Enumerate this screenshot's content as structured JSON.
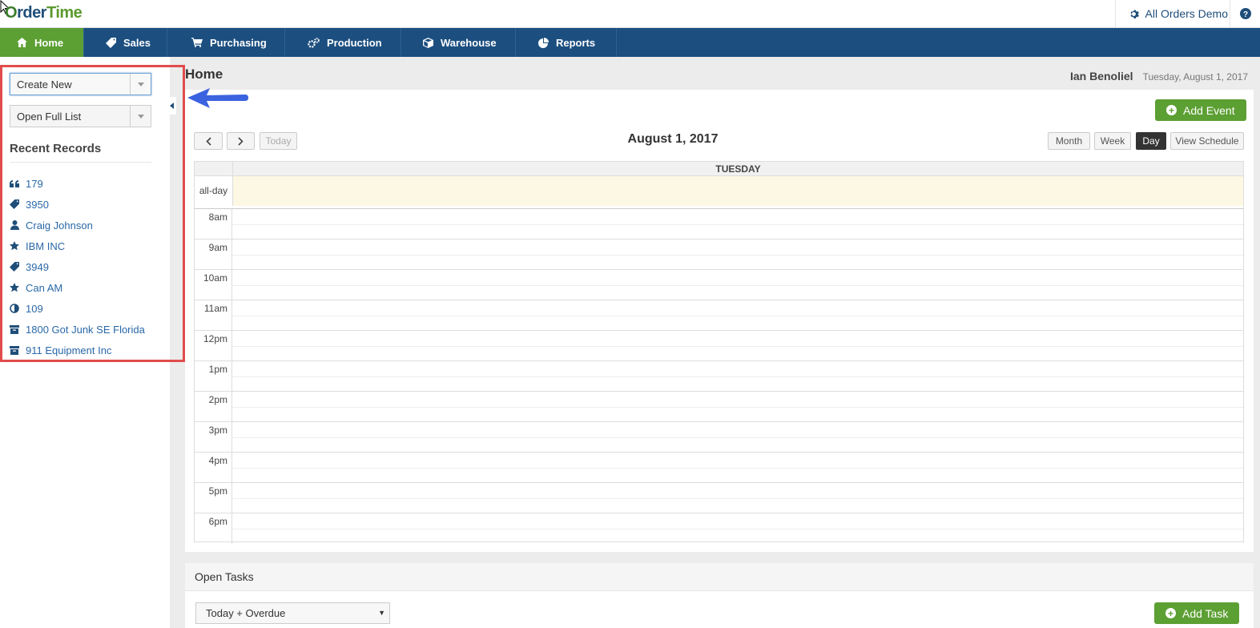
{
  "app": {
    "logo_o": "O",
    "logo_rder": "rder",
    "logo_time": "Time"
  },
  "account": {
    "company": "All Orders Demo"
  },
  "nav": [
    {
      "label": "Home",
      "icon": "home-icon",
      "active": true
    },
    {
      "label": "Sales",
      "icon": "tag-icon",
      "active": false
    },
    {
      "label": "Purchasing",
      "icon": "cart-icon",
      "active": false
    },
    {
      "label": "Production",
      "icon": "gears-icon",
      "active": false
    },
    {
      "label": "Warehouse",
      "icon": "box-icon",
      "active": false
    },
    {
      "label": "Reports",
      "icon": "pie-chart-icon",
      "active": false
    }
  ],
  "sidebar": {
    "create_new": "Create New",
    "open_full_list": "Open Full List",
    "recent_heading": "Recent Records",
    "recent": [
      {
        "label": "179",
        "icon": "quote-icon"
      },
      {
        "label": "3950",
        "icon": "tag-icon"
      },
      {
        "label": "Craig Johnson",
        "icon": "user-icon"
      },
      {
        "label": "IBM INC",
        "icon": "star-icon"
      },
      {
        "label": "3949",
        "icon": "tag-icon"
      },
      {
        "label": "Can AM",
        "icon": "star-icon"
      },
      {
        "label": "109",
        "icon": "half-circle-icon"
      },
      {
        "label": "1800 Got Junk SE Florida",
        "icon": "archive-icon"
      },
      {
        "label": "911 Equipment Inc",
        "icon": "archive-icon"
      }
    ]
  },
  "page": {
    "title": "Home",
    "user_name": "Ian Benoliel",
    "date": "Tuesday, August 1, 2017"
  },
  "calendar": {
    "add_event": "Add Event",
    "prev": "<",
    "next": ">",
    "today": "Today",
    "title": "August 1, 2017",
    "views": {
      "month": "Month",
      "week": "Week",
      "day": "Day",
      "schedule": "View Schedule"
    },
    "active_view": "Day",
    "day_name": "TUESDAY",
    "all_day": "all-day",
    "hours": [
      "8am",
      "9am",
      "10am",
      "11am",
      "12pm",
      "1pm",
      "2pm",
      "3pm",
      "4pm",
      "5pm",
      "6pm"
    ]
  },
  "tasks": {
    "heading": "Open Tasks",
    "filter": "Today + Overdue",
    "add_task": "Add Task"
  },
  "colors": {
    "nav_bg": "#1c4f80",
    "active_green": "#5c9f33",
    "link_blue": "#2a68a8",
    "highlight_red": "#e24b4b",
    "arrow_blue": "#3b63e0",
    "allday_bg": "#fdf8e3"
  }
}
